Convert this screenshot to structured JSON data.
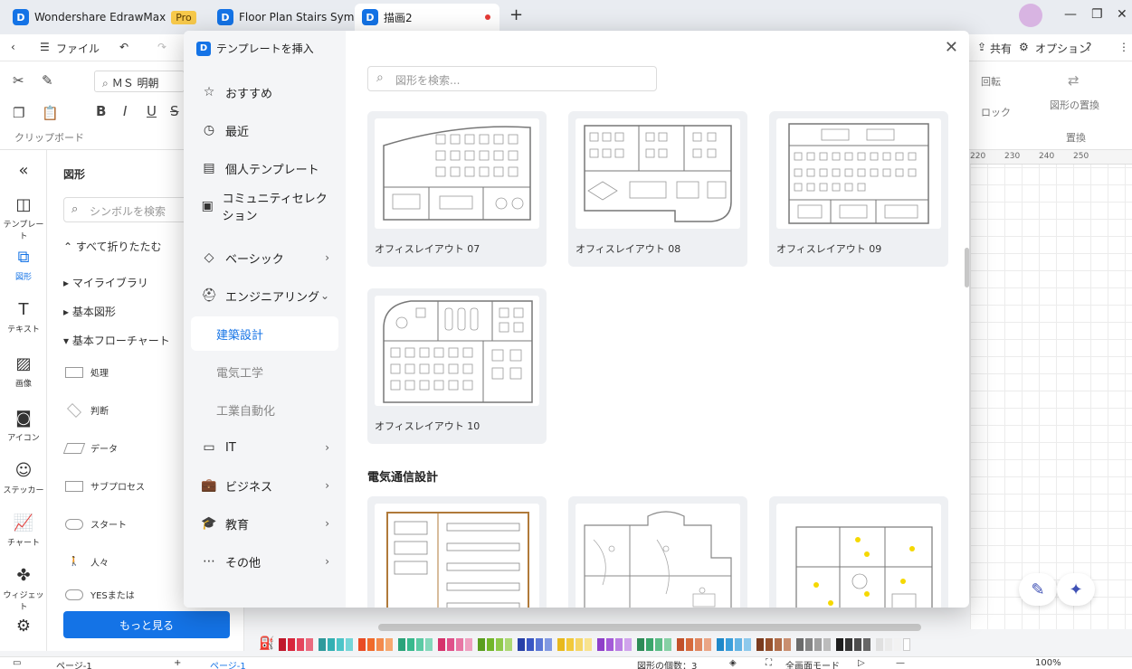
{
  "titlebar": {
    "app_name": "Wondershare EdrawMax",
    "badge": "Pro",
    "tabs": [
      {
        "label": "Floor Plan Stairs Sym..."
      },
      {
        "label": "描画2"
      }
    ]
  },
  "menubar": {
    "file": "ファイル",
    "share": "共有",
    "options": "オプション"
  },
  "ribbon": {
    "font_name": "ＭＳ 明朝",
    "clipboard_label": "クリップボード",
    "rotate": "回転",
    "lock": "ロック",
    "replace_shape": "図形の置換",
    "replace_group": "置換"
  },
  "rail": [
    {
      "label": "テンプレート"
    },
    {
      "label": "図形"
    },
    {
      "label": "テキスト"
    },
    {
      "label": "画像"
    },
    {
      "label": "アイコン"
    },
    {
      "label": "ステッカー"
    },
    {
      "label": "チャート"
    },
    {
      "label": "ウィジェット"
    }
  ],
  "shapes_panel": {
    "title": "図形",
    "search_placeholder": "シンボルを検索",
    "collapse_all": "すべて折りたたむ",
    "tree": [
      "マイライブラリ",
      "基本図形",
      "基本フローチャート"
    ],
    "shapes": [
      "処理",
      "判断",
      "データ",
      "サブプロセス",
      "スタート",
      "人々",
      "YESまたは"
    ],
    "more_button": "もっと見る"
  },
  "ruler": [
    "220",
    "230",
    "240",
    "250"
  ],
  "modal": {
    "title": "テンプレートを挿入",
    "search_placeholder": "図形を検索...",
    "nav": [
      {
        "label": "おすすめ"
      },
      {
        "label": "最近"
      },
      {
        "label": "個人テンプレート"
      },
      {
        "label": "コミュニティセレクション"
      },
      {
        "label": "ベーシック"
      },
      {
        "label": "エンジニアリング"
      },
      {
        "label": "建築設計"
      },
      {
        "label": "電気工学"
      },
      {
        "label": "工業自動化"
      },
      {
        "label": "IT"
      },
      {
        "label": "ビジネス"
      },
      {
        "label": "教育"
      },
      {
        "label": "その他"
      }
    ],
    "templates": [
      {
        "label": "オフィスレイアウト 07"
      },
      {
        "label": "オフィスレイアウト 08"
      },
      {
        "label": "オフィスレイアウト 09"
      },
      {
        "label": "オフィスレイアウト 10"
      }
    ],
    "section2_title": "電気通信設計"
  },
  "statusbar": {
    "page_tab": "ページ-1",
    "page_active": "ページ-1",
    "shape_count": "図形の個数：3",
    "fullscreen": "全画面モード",
    "zoom": "100%"
  },
  "colors": {
    "accent": "#1473e6",
    "palette": [
      "#c0182b",
      "#d8263c",
      "#e5455d",
      "#ea6b7f",
      "#2f9a9c",
      "#33b0b3",
      "#4cc5c8",
      "#75d6d8",
      "#e94c24",
      "#f06b2b",
      "#f38a4c",
      "#f6a86f",
      "#2aa37a",
      "#38b98d",
      "#5bcaa4",
      "#84d8bb",
      "#d6336c",
      "#e0518a",
      "#e876a4",
      "#efa0c0",
      "#5a9e1f",
      "#72b62a",
      "#8fc94a",
      "#acd874",
      "#2740a8",
      "#3a57c4",
      "#5b77d6",
      "#8199e2",
      "#e8b91c",
      "#f2c93a",
      "#f5d666",
      "#f8e38f",
      "#8f3fc9",
      "#a45ad8",
      "#ba7ee3",
      "#d0a3ec",
      "#2e8b57",
      "#3aa56a",
      "#5cbd86",
      "#86d0a5",
      "#c2502a",
      "#d66a3c",
      "#e08760",
      "#eaa585",
      "#1e88c9",
      "#3a9edb",
      "#63b4e4",
      "#8dc9ec",
      "#7a3b1e",
      "#96502c",
      "#b06d49",
      "#c98f70",
      "#6b6b6b",
      "#858585",
      "#a0a0a0",
      "#bcbcbc",
      "#1d1d1d",
      "#353535",
      "#4d4d4d",
      "#666666",
      "#e0e0e0",
      "#ebebeb",
      "#f2f2f2",
      "#ffffff"
    ]
  }
}
